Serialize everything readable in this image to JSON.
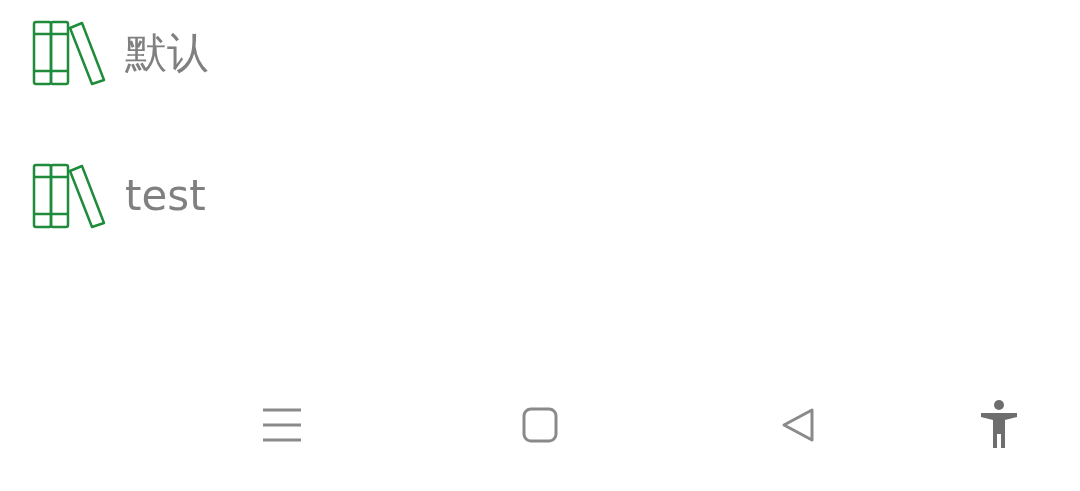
{
  "books": [
    {
      "name": "默认"
    },
    {
      "name": "test"
    }
  ]
}
